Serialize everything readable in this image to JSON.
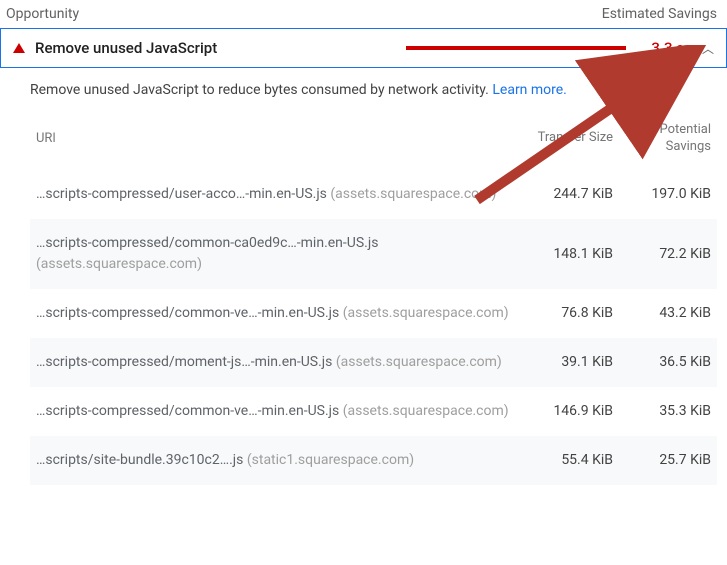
{
  "header": {
    "opportunity_label": "Opportunity",
    "estimated_savings_label": "Estimated Savings"
  },
  "audit": {
    "title": "Remove unused JavaScript",
    "savings_display": "3.3 s",
    "description_text": "Remove unused JavaScript to reduce bytes consumed by network activity. ",
    "learn_more_label": "Learn more."
  },
  "table": {
    "columns": {
      "url": "URl",
      "transfer_size": "Transfer Size",
      "potential_savings": "Potential Savings"
    },
    "rows": [
      {
        "path": "…scripts-compressed/user-acco…-min.en-US.js",
        "host": "(assets.squarespace.com)",
        "transfer": "244.7 KiB",
        "savings": "197.0 KiB"
      },
      {
        "path": "…scripts-compressed/common-ca0ed9c…-min.en-US.js",
        "host": "(assets.squarespace.com)",
        "transfer": "148.1 KiB",
        "savings": "72.2 KiB"
      },
      {
        "path": "…scripts-compressed/common-ve…-min.en-US.js",
        "host": "(assets.squarespace.com)",
        "transfer": "76.8 KiB",
        "savings": "43.2 KiB"
      },
      {
        "path": "…scripts-compressed/moment-js…-min.en-US.js",
        "host": "(assets.squarespace.com)",
        "transfer": "39.1 KiB",
        "savings": "36.5 KiB"
      },
      {
        "path": "…scripts-compressed/common-ve…-min.en-US.js",
        "host": "(assets.squarespace.com)",
        "transfer": "146.9 KiB",
        "savings": "35.3 KiB"
      },
      {
        "path": "…scripts/site-bundle.39c10c2….js",
        "host": "(static1.squarespace.com)",
        "transfer": "55.4 KiB",
        "savings": "25.7 KiB"
      }
    ]
  }
}
